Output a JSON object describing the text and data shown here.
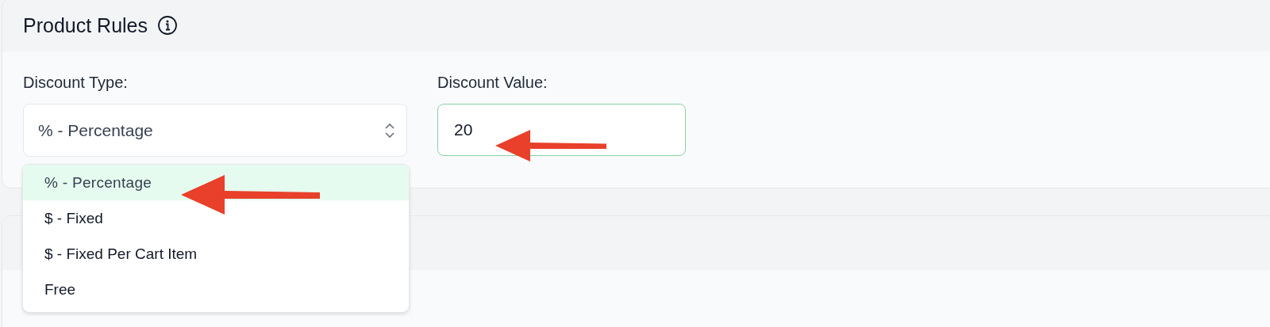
{
  "card": {
    "title": "Product Rules"
  },
  "discount_type": {
    "label": "Discount Type:",
    "value": "% - Percentage",
    "expanded": true,
    "options": [
      {
        "label": "% - Percentage",
        "selected": true
      },
      {
        "label": "$ - Fixed",
        "selected": false
      },
      {
        "label": "$ - Fixed Per Cart Item",
        "selected": false
      },
      {
        "label": "Free",
        "selected": false
      }
    ]
  },
  "discount_value": {
    "label": "Discount Value:",
    "value": "20"
  }
}
